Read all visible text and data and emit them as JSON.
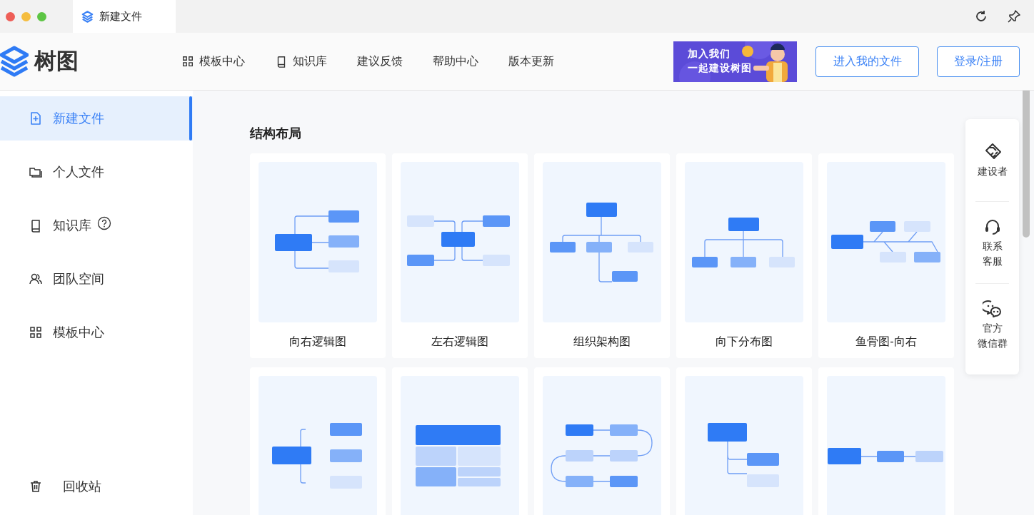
{
  "window": {
    "tab_title": "新建文件"
  },
  "header": {
    "logo_text": "树图",
    "nav": [
      {
        "label": "模板中心",
        "kind": "grid"
      },
      {
        "label": "知识库",
        "kind": "book"
      },
      {
        "label": "建议反馈",
        "kind": "plain"
      },
      {
        "label": "帮助中心",
        "kind": "plain"
      },
      {
        "label": "版本更新",
        "kind": "plain"
      }
    ],
    "banner": {
      "lines": [
        "加入我们",
        "一起建设树图"
      ]
    },
    "buttons": [
      "进入我的文件",
      "登录/注册"
    ]
  },
  "sidebar": {
    "items": [
      {
        "label": "新建文件",
        "kind": "file-plus",
        "selected": true,
        "help": false
      },
      {
        "label": "个人文件",
        "kind": "folder",
        "selected": false,
        "help": false
      },
      {
        "label": "知识库",
        "kind": "book",
        "selected": false,
        "help": true
      },
      {
        "label": "团队空间",
        "kind": "users",
        "selected": false,
        "help": false
      },
      {
        "label": "模板中心",
        "kind": "grid",
        "selected": false,
        "help": false
      }
    ],
    "bottom_item": {
      "label": "回收站"
    }
  },
  "section": {
    "title": "结构布局",
    "cards": [
      {
        "kind": "logic-right",
        "label": "向右逻辑图"
      },
      {
        "kind": "logic-both",
        "label": "左右逻辑图"
      },
      {
        "kind": "org",
        "label": "组织架构图"
      },
      {
        "kind": "down",
        "label": "向下分布图"
      },
      {
        "kind": "fishbone",
        "label": "鱼骨图-向右"
      },
      {
        "kind": "brace"
      },
      {
        "kind": "table"
      },
      {
        "kind": "timeline"
      },
      {
        "kind": "tree"
      },
      {
        "kind": "line"
      }
    ]
  },
  "float_panel": [
    {
      "kind": "handshake",
      "lines": [
        "建设者"
      ]
    },
    {
      "kind": "headset",
      "lines": [
        "联系",
        "客服"
      ]
    },
    {
      "kind": "chat",
      "lines": [
        "官方",
        "微信群"
      ]
    }
  ]
}
